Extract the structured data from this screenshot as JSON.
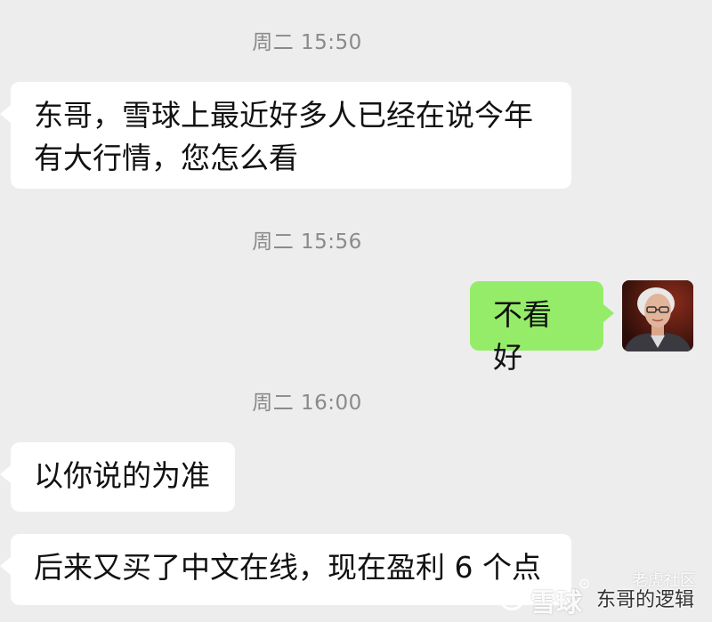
{
  "messages": [
    {
      "type": "timestamp",
      "text": "周二 15:50"
    },
    {
      "type": "incoming",
      "text_line1": "东哥，雪球上最近好多人已经在说今年",
      "text_line2": "有大行情，您怎么看"
    },
    {
      "type": "timestamp",
      "text": "周二 15:56"
    },
    {
      "type": "outgoing",
      "text": "不看好"
    },
    {
      "type": "timestamp",
      "text": "周二 16:00"
    },
    {
      "type": "incoming",
      "text": "以你说的为准"
    },
    {
      "type": "incoming",
      "text": "后来又买了中文在线，现在盈利 6 个点"
    }
  ],
  "watermark": {
    "site": "雪球",
    "name": "东哥的逻辑",
    "top": "老虎社区"
  },
  "avatar": {
    "icon": "portrait-avatar-icon"
  },
  "colors": {
    "background": "#ededed",
    "incoming_bubble": "#ffffff",
    "outgoing_bubble": "#95ec69",
    "timestamp": "#8a8a8a"
  }
}
